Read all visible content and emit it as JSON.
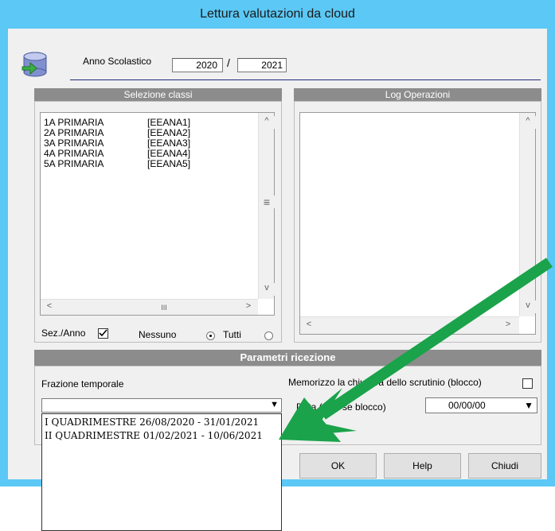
{
  "window": {
    "title": "Lettura valutazioni da cloud"
  },
  "header": {
    "year_label": "Anno Scolastico",
    "year_from": "2020",
    "year_sep": "/",
    "year_to": "2021"
  },
  "classes": {
    "title": "Selezione classi",
    "items": [
      {
        "name": "1A PRIMARIA",
        "code": "[EEANA1]"
      },
      {
        "name": "2A PRIMARIA",
        "code": "[EEANA2]"
      },
      {
        "name": "3A PRIMARIA",
        "code": "[EEANA3]"
      },
      {
        "name": "4A PRIMARIA",
        "code": "[EEANA4]"
      },
      {
        "name": "5A PRIMARIA",
        "code": "[EEANA5]"
      }
    ],
    "sez_anno_label": "Sez./Anno",
    "sez_anno_checked": true,
    "nessuno_label": "Nessuno",
    "tutti_label": "Tutti"
  },
  "log": {
    "title": "Log Operazioni"
  },
  "params": {
    "title": "Parametri ricezione",
    "frazione_label": "Frazione temporale",
    "frazione_value": "",
    "options": [
      "I QUADRIMESTRE 26/08/2020 - 31/01/2021",
      "II QUADRIMESTRE 01/02/2021 - 10/06/2021"
    ],
    "memorizzo_label": "Memorizzo la chiusura dello scrutinio (blocco)",
    "data_label": "Data (solo se blocco)",
    "data_value": "00/00/00"
  },
  "buttons": {
    "ok": "OK",
    "help": "Help",
    "chiudi": "Chiudi"
  },
  "scroll": {
    "left": "<",
    "right": ">",
    "up": "^",
    "down": "v",
    "thumb": "III",
    "vthumb": "≡",
    "combo_arrow": "▼"
  },
  "colors": {
    "titlebar": "#5bc8f5",
    "group_header": "#8c8c8c",
    "arrow": "#1aa34a"
  }
}
